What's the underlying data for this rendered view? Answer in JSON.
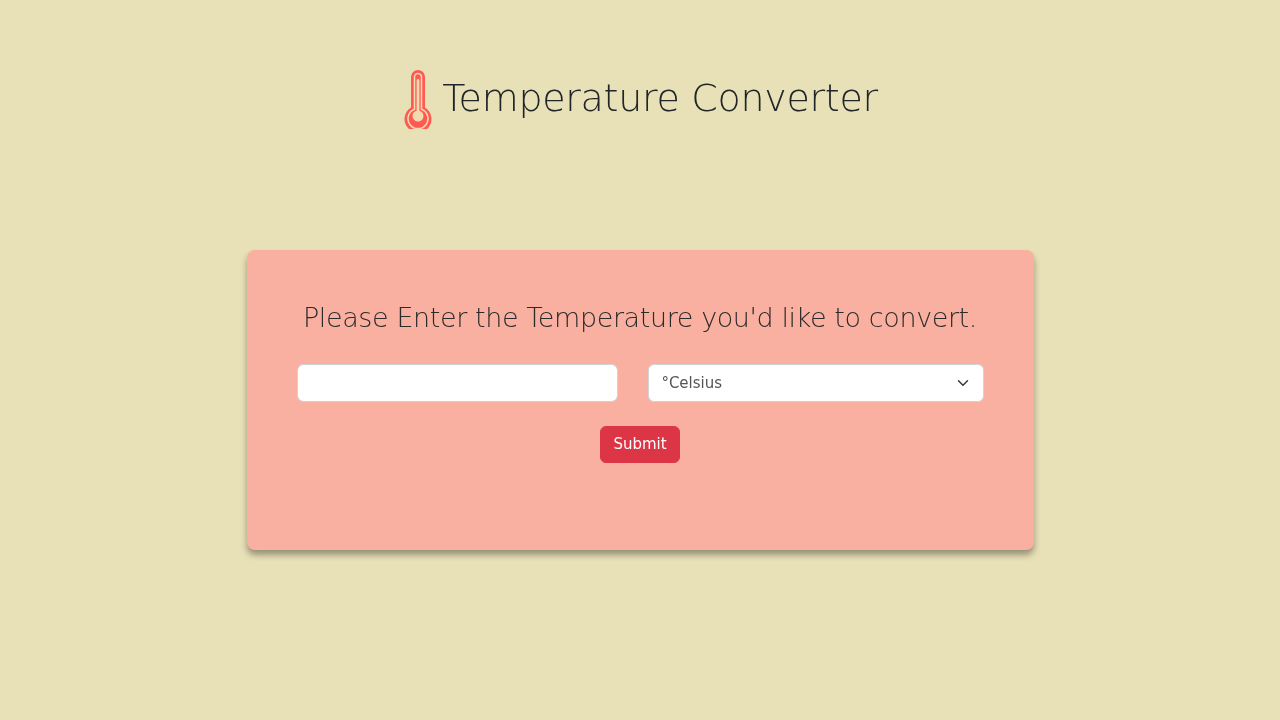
{
  "header": {
    "title": "Temperature Converter"
  },
  "converter": {
    "prompt": "Please Enter the Temperature you'd like to convert.",
    "unit_select": {
      "value": "°Celsius"
    },
    "submit_button": {
      "label": "Submit"
    }
  }
}
